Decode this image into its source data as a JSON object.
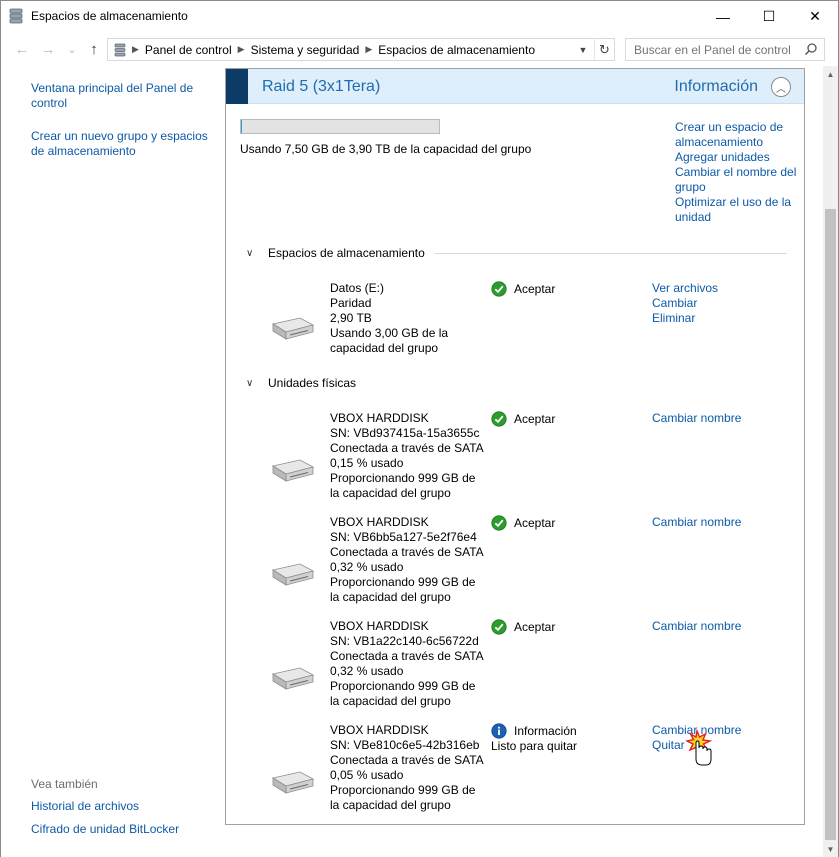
{
  "window": {
    "title": "Espacios de almacenamiento",
    "minimize_glyph": "—",
    "maximize_glyph": "☐",
    "close_glyph": "✕"
  },
  "nav": {
    "back_glyph": "←",
    "forward_glyph": "→",
    "recent_glyph": "⌄",
    "up_glyph": "↑",
    "breadcrumbs": [
      "Panel de control",
      "Sistema y seguridad",
      "Espacios de almacenamiento"
    ],
    "search_placeholder": "Buscar en el Panel de control"
  },
  "sidebar": {
    "links": [
      "Ventana principal del Panel de control",
      "Crear un nuevo grupo y espacios de almacenamiento"
    ],
    "see_also_label": "Vea también",
    "see_also": [
      "Historial de archivos",
      "Cifrado de unidad BitLocker"
    ]
  },
  "pool": {
    "name": "Raid 5 (3x1Tera)",
    "status": "Información",
    "usage_fraction": 0.002,
    "usage_text": "Usando 7,50 GB de 3,90 TB de la capacidad del grupo",
    "actions": [
      "Crear un espacio de almacenamiento",
      "Agregar unidades",
      "Cambiar el nombre del grupo",
      "Optimizar el uso de la unidad"
    ]
  },
  "spaces_section": {
    "title": "Espacios de almacenamiento",
    "items": [
      {
        "lines": [
          "Datos (E:)",
          "Paridad",
          "2,90 TB",
          "Usando 3,00 GB de la capacidad del grupo"
        ],
        "status": "Aceptar",
        "status_icon": "ok-icon",
        "links": [
          "Ver archivos",
          "Cambiar",
          "Eliminar"
        ]
      }
    ]
  },
  "drives_section": {
    "title": "Unidades físicas",
    "items": [
      {
        "lines": [
          "VBOX HARDDISK",
          "SN: VBd937415a-15a3655c",
          "Conectada a través de SATA",
          "0,15 % usado",
          "Proporcionando 999 GB de la capacidad del grupo"
        ],
        "status": "Aceptar",
        "status_icon": "ok-icon",
        "links": [
          "Cambiar nombre"
        ]
      },
      {
        "lines": [
          "VBOX HARDDISK",
          "SN: VB6bb5a127-5e2f76e4",
          "Conectada a través de SATA",
          "0,32 % usado",
          "Proporcionando 999 GB de la capacidad del grupo"
        ],
        "status": "Aceptar",
        "status_icon": "ok-icon",
        "links": [
          "Cambiar nombre"
        ]
      },
      {
        "lines": [
          "VBOX HARDDISK",
          "SN: VB1a22c140-6c56722d",
          "Conectada a través de SATA",
          "0,32 % usado",
          "Proporcionando 999 GB de la capacidad del grupo"
        ],
        "status": "Aceptar",
        "status_icon": "ok-icon",
        "links": [
          "Cambiar nombre"
        ]
      },
      {
        "lines": [
          "VBOX HARDDISK",
          "SN: VBe810c6e5-42b316eb",
          "Conectada a través de SATA",
          "0,05 % usado",
          "Proporcionando 999 GB de la capacidad del grupo"
        ],
        "status": "Información",
        "status_sub": "Listo para quitar",
        "status_icon": "info-icon",
        "links": [
          "Cambiar nombre",
          "Quitar"
        ]
      }
    ]
  },
  "colors": {
    "link": "#0d5aa7",
    "header_bg": "#deeefa",
    "header_bar": "#0b3b66",
    "ok_green": "#2e9b2e",
    "info_blue": "#1c5fb3"
  }
}
